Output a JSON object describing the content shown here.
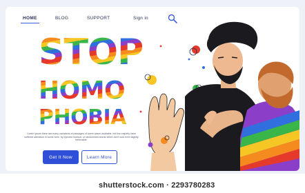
{
  "nav": {
    "home": "HOME",
    "blog": "BLOG",
    "support": "SUPPORT",
    "sign_in": "Sign in",
    "search_icon": "search-icon"
  },
  "hero": {
    "line1": "STOP",
    "line2": "HOMO",
    "line3": "PHOBIA",
    "body": "Lorem ipsum there are many variations of passages of lorem ipsum available, but the majority have suffered alteration in some form, by injected humour, or randomised words which don't look even slightly believable.",
    "primary_button": "Get It Now",
    "secondary_button": "Learn More"
  },
  "watermark": "shutterstock.com · 2293780283",
  "colors": {
    "accent": "#2f4fd8",
    "rainbow": [
      "#e5392c",
      "#f58a1f",
      "#f6c624",
      "#39b54a",
      "#2f6fde",
      "#8b3fc9"
    ]
  }
}
